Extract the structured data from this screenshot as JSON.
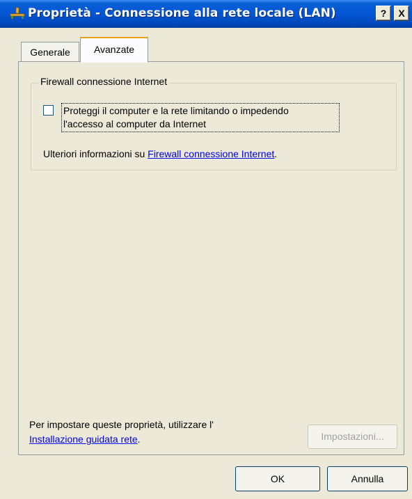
{
  "window": {
    "title": "Proprietà - Connessione alla rete locale (LAN)",
    "help_label": "?",
    "close_label": "X"
  },
  "tabs": [
    {
      "label": "Generale",
      "active": false
    },
    {
      "label": "Avanzate",
      "active": true
    }
  ],
  "firewall_group": {
    "legend": "Firewall connessione Internet",
    "checkbox_checked": false,
    "checkbox_label_line1": "Proteggi il computer e la rete limitando o impedendo",
    "checkbox_label_line2": "l'accesso al computer da Internet",
    "info_prefix": "Ulteriori informazioni su ",
    "info_link": "Firewall connessione Internet",
    "info_suffix": "."
  },
  "network_setup": {
    "text": "Per impostare queste proprietà, utilizzare l'",
    "link": "Installazione guidata rete",
    "suffix": ".",
    "settings_button": "Impostazioni..."
  },
  "buttons": {
    "ok": "OK",
    "cancel": "Annulla"
  },
  "colors": {
    "title_bar": "#0355d3",
    "dialog_bg": "#ece9d8",
    "link": "#0000ee",
    "active_tab_accent": "#e6a21a"
  }
}
